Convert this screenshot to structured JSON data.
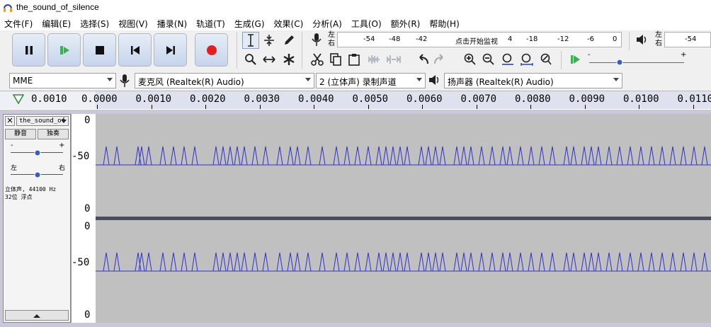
{
  "window": {
    "title": "the_sound_of_silence"
  },
  "menu": [
    "文件(F)",
    "编辑(E)",
    "选择(S)",
    "视图(V)",
    "播录(N)",
    "轨道(T)",
    "生成(G)",
    "效果(C)",
    "分析(A)",
    "工具(O)",
    "额外(R)",
    "帮助(H)"
  ],
  "meter": {
    "rec_lr": [
      "左",
      "右"
    ],
    "rec_ticks": [
      "-54",
      "-48",
      "-42",
      "点击开始监视",
      "-18",
      "-12",
      "-6",
      "0"
    ],
    "play_lr": [
      "左",
      "右"
    ],
    "play_ticks": [
      "-54"
    ]
  },
  "device": {
    "host": "MME",
    "mic": "麦克风 (Realtek(R) Audio)",
    "channels": "2 (立体声) 录制声道",
    "speaker": "扬声器 (Realtek(R) Audio)"
  },
  "ruler": {
    "start": "0.0010",
    "ticks": [
      "0.0000",
      "0.0010",
      "0.0020",
      "0.0030",
      "0.0040",
      "0.0050",
      "0.0060",
      "0.0070",
      "0.0080",
      "0.0090",
      "0.0100",
      "0.0110"
    ]
  },
  "track": {
    "name": "the_sound_of",
    "mute": "静音",
    "solo": "独奏",
    "gain_minus": "-",
    "gain_plus": "+",
    "pan_left": "左",
    "pan_right": "右",
    "info_line1": "立体声, 44100 Hz",
    "info_line2": "32位 浮点",
    "vruler": [
      "0",
      "-50",
      "0",
      "0",
      "-50",
      "0"
    ]
  },
  "colors": {
    "wave": "#3232c8",
    "wave_bg": "#c0c0c0",
    "record": "#e02020"
  },
  "waveform": {
    "peak_times": [
      0.05,
      0.2,
      0.5,
      0.55,
      0.65,
      0.85,
      1.0,
      1.15,
      1.3,
      1.6,
      1.7,
      1.8,
      1.9,
      2.0,
      2.15,
      2.3,
      2.5,
      2.65,
      2.75,
      2.9,
      3.1,
      3.3,
      3.45,
      3.6,
      3.75,
      3.9,
      4.0,
      4.1,
      4.2,
      4.3,
      4.5,
      4.6,
      4.7,
      4.8,
      5.0,
      5.1,
      5.2,
      5.35,
      5.5,
      5.65,
      5.75,
      5.9,
      6.05,
      6.2,
      6.35,
      6.55,
      6.65,
      6.8,
      6.9,
      7.0,
      7.15,
      7.3,
      7.45,
      7.6,
      7.75,
      7.9,
      8.05,
      8.2,
      8.35,
      8.5
    ]
  }
}
